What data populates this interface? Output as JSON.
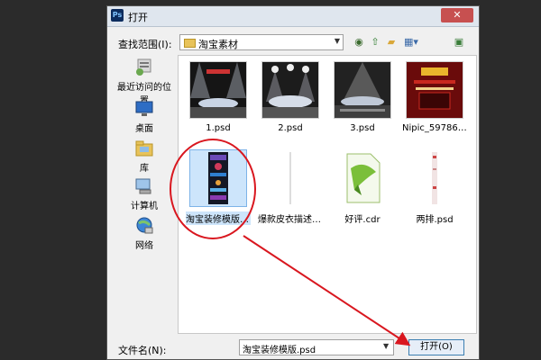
{
  "window": {
    "title": "打开",
    "close_glyph": "✕"
  },
  "toolbar": {
    "look_in_label": "查找范围(I):",
    "look_in_value": "淘宝素材",
    "back_glyph": "◉",
    "up_glyph": "⇧",
    "new_folder_glyph": "▰",
    "views_glyph": "▦▾",
    "extra_glyph": "▣"
  },
  "places": [
    {
      "label": "最近访问的位置",
      "icon": "recent-places-icon"
    },
    {
      "label": "桌面",
      "icon": "desktop-icon"
    },
    {
      "label": "库",
      "icon": "libraries-icon"
    },
    {
      "label": "计算机",
      "icon": "computer-icon"
    },
    {
      "label": "网络",
      "icon": "network-icon"
    }
  ],
  "files": [
    {
      "name": "1.psd",
      "kind": "stage-thumbnail"
    },
    {
      "name": "2.psd",
      "kind": "stage-thumbnail"
    },
    {
      "name": "3.psd",
      "kind": "stage-thumbnail"
    },
    {
      "name": "Nipic_5978622_...",
      "kind": "poster-thumbnail"
    },
    {
      "name": "淘宝装修模版.psd",
      "kind": "long-page-thumbnail",
      "selected": true
    },
    {
      "name": "爆款皮衣描述.psd",
      "kind": "blank-thumbnail"
    },
    {
      "name": "好评.cdr",
      "kind": "cdr-file-icon"
    },
    {
      "name": "两排.psd",
      "kind": "strip-thumbnail"
    }
  ],
  "footer": {
    "filename_label": "文件名(N):",
    "filename_value": "淘宝装修模版.psd",
    "open_label": "打开(O)"
  },
  "colors": {
    "annotation": "#d9171f",
    "selection": "#cde5fb"
  }
}
